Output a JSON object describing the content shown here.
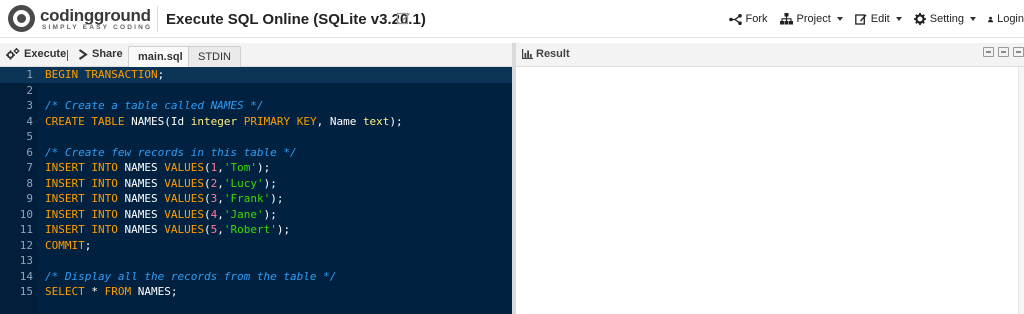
{
  "brand": {
    "logo_main": "codingground",
    "logo_sub": "SIMPLY EASY CODING"
  },
  "header": {
    "title": "Execute SQL Online (SQLite v3.20.1)",
    "nav": {
      "fork": "Fork",
      "project": "Project",
      "edit": "Edit",
      "setting": "Setting",
      "login": "Login"
    }
  },
  "toolbar": {
    "execute": "Execute",
    "share": "Share",
    "tabs": [
      "main.sql",
      "STDIN"
    ],
    "active_tab": "main.sql",
    "result": "Result"
  },
  "editor": {
    "active_line": 1,
    "lines": [
      "BEGIN TRANSACTION;",
      "",
      "/* Create a table called NAMES */",
      "CREATE TABLE NAMES(Id integer PRIMARY KEY, Name text);",
      "",
      "/* Create few records in this table */",
      "INSERT INTO NAMES VALUES(1,'Tom');",
      "INSERT INTO NAMES VALUES(2,'Lucy');",
      "INSERT INTO NAMES VALUES(3,'Frank');",
      "INSERT INTO NAMES VALUES(4,'Jane');",
      "INSERT INTO NAMES VALUES(5,'Robert');",
      "COMMIT;",
      "",
      "/* Display all the records from the table */",
      "SELECT * FROM NAMES;"
    ]
  },
  "colors": {
    "editor_bg": "#002240",
    "gutter_bg": "#011e3a",
    "keyword": "#ff9d00",
    "type": "#ffee80",
    "number": "#ff7b9c",
    "string": "#3ad900",
    "comment": "#2f9cf5"
  },
  "icons": {
    "fork": "fork-icon",
    "project": "sitemap-icon",
    "edit": "edit-icon",
    "setting": "gear-icon",
    "login": "user-icon",
    "execute": "gears-icon",
    "share": "share-chevron-icon",
    "result": "bar-chart-icon"
  }
}
